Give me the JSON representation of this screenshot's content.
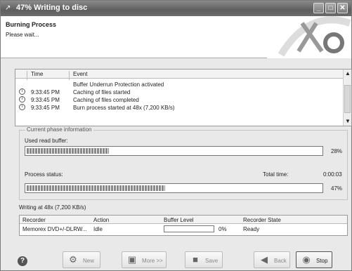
{
  "window": {
    "title": "47% Writing to disc"
  },
  "header": {
    "title": "Burning Process",
    "subtitle": "Please wait..."
  },
  "log": {
    "columns": [
      "Time",
      "Event"
    ],
    "rows": [
      {
        "time": "",
        "event": "Buffer Underrun Protection activated"
      },
      {
        "time": "9:33:45 PM",
        "event": "Caching of files started"
      },
      {
        "time": "9:33:45 PM",
        "event": "Caching of files completed"
      },
      {
        "time": "9:33:45 PM",
        "event": "Burn process started at 48x (7,200 KB/s)"
      }
    ]
  },
  "phase": {
    "legend": "Current phase information",
    "buffer_label": "Used read buffer:",
    "buffer_pct_text": "28%",
    "buffer_fraction": 0.28,
    "status_label": "Process status:",
    "total_time_label": "Total time:",
    "total_time": "0:00:03",
    "status_pct_text": "47%",
    "status_fraction": 0.47
  },
  "writing": "Writing at 48x (7,200 KB/s)",
  "recorder": {
    "columns": [
      "Recorder",
      "Action",
      "Buffer Level",
      "Recorder State"
    ],
    "row": {
      "recorder": "Memorex DVD+/-DLRW...",
      "action": "Idle",
      "buffer": "0%",
      "state": "Ready"
    }
  },
  "buttons": {
    "new": "New",
    "more": "More >>",
    "save": "Save",
    "back": "Back",
    "stop": "Stop"
  }
}
